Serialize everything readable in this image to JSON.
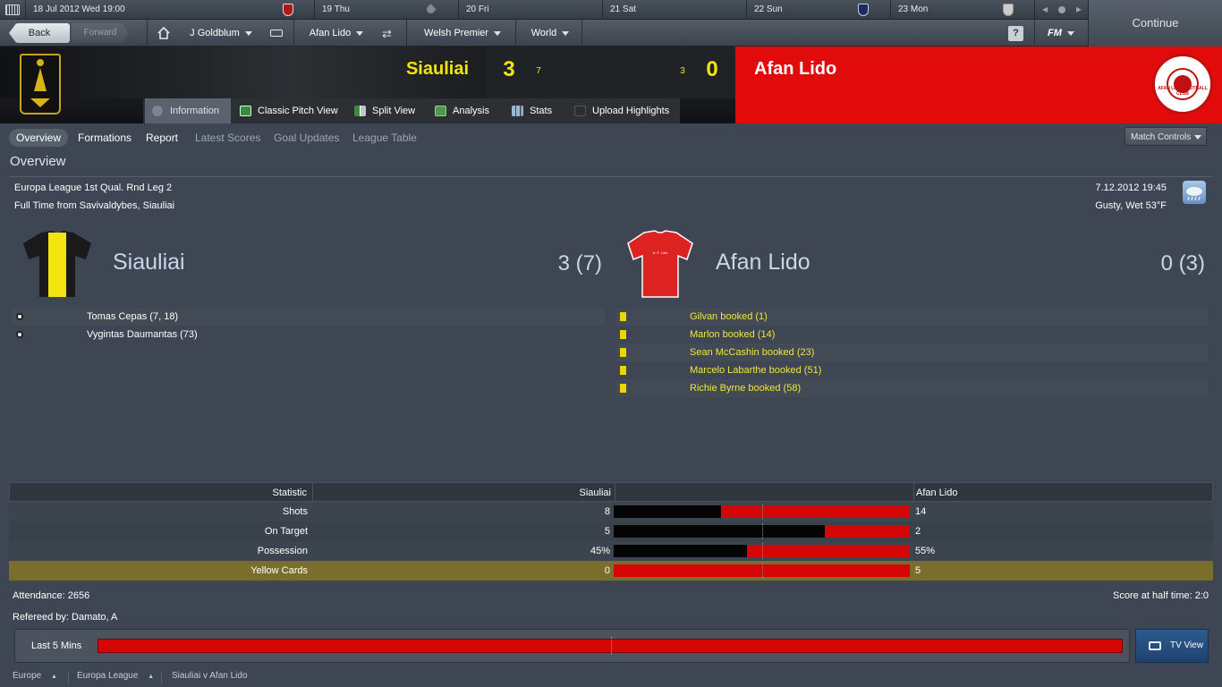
{
  "calendar": {
    "current": "18 Jul 2012  Wed  19:00",
    "days": [
      "19  Thu",
      "20  Fri",
      "21  Sat",
      "22  Sun",
      "23  Mon"
    ]
  },
  "nav": {
    "back": "Back",
    "forward": "Forward",
    "manager": "J Goldblum",
    "club": "Afan Lido",
    "league": "Welsh Premier",
    "world": "World",
    "help": "?",
    "fm": "FM",
    "continue": "Continue"
  },
  "match": {
    "home_team": "Siauliai",
    "home_score": "3",
    "home_agg": "7",
    "away_agg": "3",
    "away_score": "0",
    "away_team": "Afan Lido",
    "away_crest_text": "AFAN LIDO FOOTBALL CLUB"
  },
  "tabs": [
    "Information",
    "Classic Pitch View",
    "Split View",
    "Analysis",
    "Stats",
    "Upload Highlights"
  ],
  "subnav": [
    "Overview",
    "Formations",
    "Report",
    "Latest Scores",
    "Goal Updates",
    "League Table"
  ],
  "match_controls": "Match Controls",
  "overview": {
    "heading": "Overview",
    "competition": "Europa League 1st Qual. Rnd Leg 2",
    "venue": "Full Time from Savivaldybes, Siauliai",
    "datetime": "7.12.2012 19:45",
    "weather": "Gusty, Wet 53°F",
    "home_name": "Siauliai",
    "home_result": "3 (7)",
    "away_name": "Afan Lido",
    "away_result": "0 (3)",
    "away_kit_text": "A. F. Lido",
    "home_events": [
      "Tomas Cepas (7, 18)",
      "Vygintas Daumantas (73)"
    ],
    "away_events": [
      "Gilvan booked (1)",
      "Marlon booked (14)",
      "Sean McCashin booked (23)",
      "Marcelo Labarthe booked (51)",
      "Richie Byrne booked (58)"
    ]
  },
  "stats": {
    "header": {
      "label": "Statistic",
      "home": "Siauliai",
      "away": "Afan Lido"
    },
    "rows": [
      {
        "label": "Shots",
        "home": "8",
        "away": "14",
        "home_share": 0.364
      },
      {
        "label": "On Target",
        "home": "5",
        "away": "2",
        "home_share": 0.714
      },
      {
        "label": "Possession",
        "home": "45%",
        "away": "55%",
        "home_share": 0.45
      },
      {
        "label": "Yellow Cards",
        "home": "0",
        "away": "5",
        "home_share": 0.0
      }
    ]
  },
  "attendance": "Attendance: 2656",
  "halftime": "Score at half time: 2:0",
  "referee": "Refereed by: Damato, A",
  "last5": "Last 5 Mins",
  "tvview": "TV View",
  "breadcrumb": [
    "Europe",
    "Europa League",
    "Siauliai v Afan Lido"
  ],
  "colors": {
    "home_yellow": "#f1e40f",
    "away_red": "#e10b0b",
    "booking_yellow": "#f0d400",
    "highlight_row": "#7a6e2c"
  }
}
